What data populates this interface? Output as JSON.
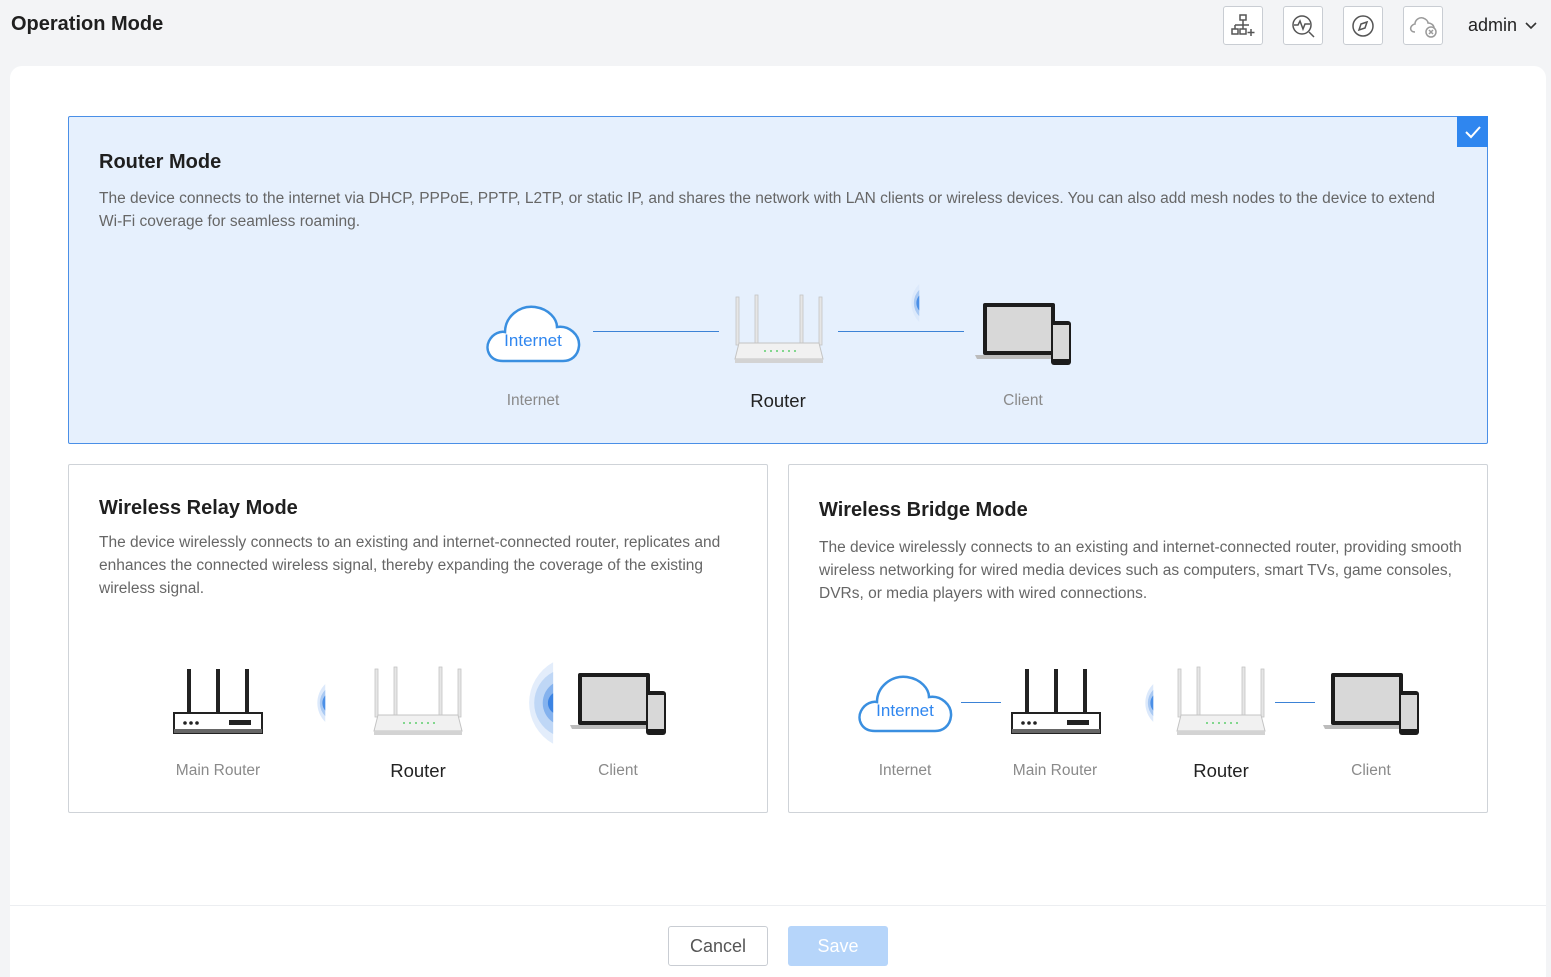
{
  "header": {
    "title": "Operation Mode",
    "user": "admin"
  },
  "toolbar_icons": [
    "network-topology-add-icon",
    "diagnose-icon",
    "compass-icon",
    "cloud-disconnected-icon"
  ],
  "modes": [
    {
      "title": "Router Mode",
      "description": "The device connects to the internet via DHCP, PPPoE, PPTP, L2TP, or static IP, and shares the network with LAN clients or wireless devices. You can also add mesh nodes to the device to extend Wi-Fi coverage for seamless roaming.",
      "selected": true,
      "nodes": [
        {
          "label": "Internet",
          "icon_text": "Internet"
        },
        {
          "label": "Router"
        },
        {
          "label": "Client"
        }
      ]
    },
    {
      "title": "Wireless Relay Mode",
      "description": "The device wirelessly connects to an existing and internet-connected router, replicates and enhances the connected wireless signal, thereby expanding the coverage of the existing wireless signal.",
      "selected": false,
      "nodes": [
        {
          "label": "Main Router"
        },
        {
          "label": "Router"
        },
        {
          "label": "Client"
        }
      ]
    },
    {
      "title": "Wireless Bridge Mode",
      "description": "The device wirelessly connects to an existing and internet-connected router, providing smooth wireless networking for wired media devices such as computers, smart TVs, game consoles, DVRs, or media players with wired connections.",
      "selected": false,
      "nodes": [
        {
          "label": "Internet",
          "icon_text": "Internet"
        },
        {
          "label": "Main Router"
        },
        {
          "label": "Router"
        },
        {
          "label": "Client"
        }
      ]
    }
  ],
  "buttons": {
    "cancel": "Cancel",
    "save": "Save"
  },
  "colors": {
    "accent": "#2f86ef",
    "selected_bg": "#e6f0fd",
    "save_disabled": "#b6d5fa"
  }
}
